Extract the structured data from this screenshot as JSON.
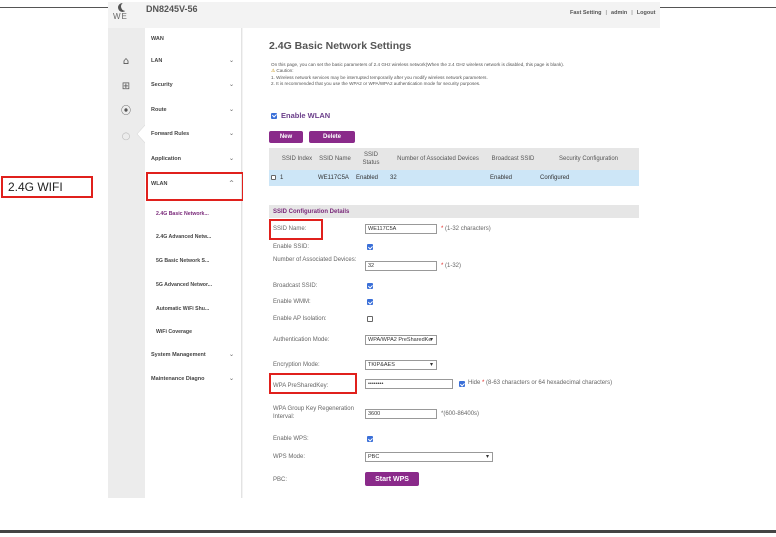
{
  "header": {
    "logo_text": "WE",
    "device": "DN8245V-56",
    "links": [
      "Fast Setting",
      "admin",
      "Logout"
    ]
  },
  "callout": {
    "label": "2.4G WIFI"
  },
  "rail_icons": [
    "home-icon",
    "plus-box-icon",
    "compass-icon",
    "forward-icon"
  ],
  "menu": {
    "items": [
      {
        "label": "WAN",
        "chevron": ""
      },
      {
        "label": "LAN",
        "chevron": "⌄"
      },
      {
        "label": "Security",
        "chevron": "⌄"
      },
      {
        "label": "Route",
        "chevron": "⌄"
      },
      {
        "label": "Forward Rules",
        "chevron": "⌄"
      },
      {
        "label": "Application",
        "chevron": "⌄"
      },
      {
        "label": "WLAN",
        "chevron": "^"
      }
    ],
    "subitems": [
      "2.4G Basic Network...",
      "2.4G Advanced Netw...",
      "5G Basic Network S...",
      "5G Advanced Networ...",
      "Automatic WiFi Shu...",
      "WiFi Coverage"
    ],
    "bottom_items": [
      {
        "label": "System Management",
        "chevron": "⌄"
      },
      {
        "label": "Maintenance Diagno",
        "chevron": "⌄"
      }
    ]
  },
  "page": {
    "title": "2.4G Basic Network Settings",
    "desc_line1": "On this page, you can set the basic parameters of 2.4 GHz wireless network(When the 2.4 GHz wireless network is disabled, this page is blank).",
    "caution": "Caution:",
    "desc_line2": "1. Wireless network services may be interrupted temporarily after you modify wireless network parameters.",
    "desc_line3": "2. It is recommended that you use the WPA2 or WPA/WPA2 authentication mode for security purposes.",
    "enable_wlan": "Enable WLAN",
    "new_btn": "New",
    "delete_btn": "Delete"
  },
  "table": {
    "headers": [
      "SSID Index",
      "SSID Name",
      "SSID Status",
      "Number of Associated Devices",
      "Broadcast SSID",
      "Security Configuration"
    ],
    "row": [
      "1",
      "WE117C5A",
      "Enabled",
      "32",
      "Enabled",
      "Configured"
    ]
  },
  "config": {
    "heading": "SSID Configuration Details",
    "ssid_name_label": "SSID Name:",
    "ssid_name_value": "WE117C5A",
    "ssid_name_hint": "(1-32 characters)",
    "enable_ssid_label": "Enable SSID:",
    "num_devices_label": "Number of Associated Devices:",
    "num_devices_value": "32",
    "num_devices_hint": "(1-32)",
    "broadcast_label": "Broadcast SSID:",
    "wmm_label": "Enable WMM:",
    "ap_isolation_label": "Enable AP Isolation:",
    "auth_label": "Authentication Mode:",
    "auth_value": "WPA/WPA2 PreSharedKe",
    "enc_label": "Encryption Mode:",
    "enc_value": "TKIP&AES",
    "psk_label": "WPA PreSharedKey:",
    "psk_value": "••••••••",
    "hide_label": "Hide",
    "psk_hint": "(8-63 characters or 64 hexadecimal characters)",
    "rekey_label": "WPA Group Key Regeneration Interval:",
    "rekey_value": "3600",
    "rekey_hint": "*(600-86400s)",
    "wps_label": "Enable WPS:",
    "wps_mode_label": "WPS Mode:",
    "wps_mode_value": "PBC",
    "pbc_label": "PBC:",
    "start_wps": "Start WPS",
    "required_mark": "*"
  },
  "colors": {
    "accent": "#8a2a8a",
    "highlight_box": "#e0201c",
    "table_row": "#cde6f7"
  }
}
